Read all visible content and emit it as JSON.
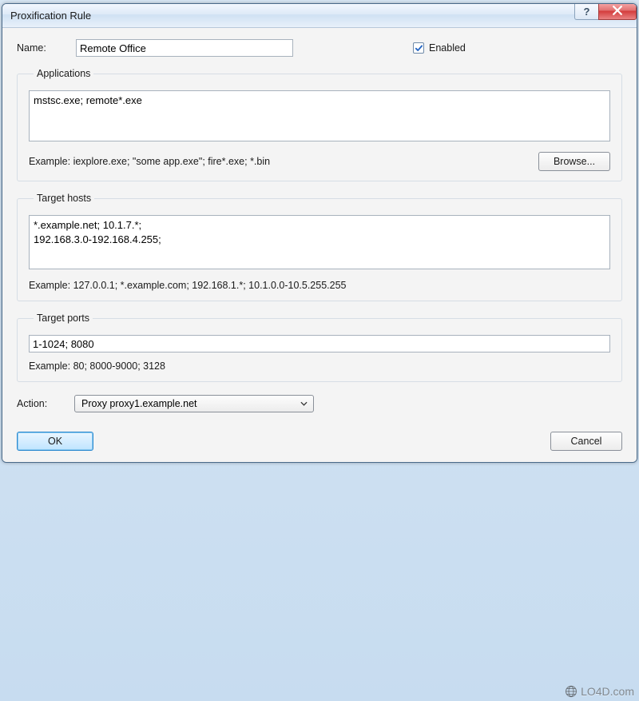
{
  "window": {
    "title": "Proxification Rule"
  },
  "name": {
    "label": "Name:",
    "value": "Remote Office"
  },
  "enabled": {
    "label": "Enabled",
    "checked": true
  },
  "applications": {
    "legend": "Applications",
    "value": "mstsc.exe; remote*.exe",
    "example": "Example: iexplore.exe; \"some app.exe\"; fire*.exe; *.bin",
    "browse_label": "Browse..."
  },
  "target_hosts": {
    "legend": "Target hosts",
    "value": "*.example.net; 10.1.7.*;\n192.168.3.0-192.168.4.255;",
    "example": "Example: 127.0.0.1; *.example.com; 192.168.1.*; 10.1.0.0-10.5.255.255"
  },
  "target_ports": {
    "legend": "Target ports",
    "value": "1-1024; 8080",
    "example": "Example: 80; 8000-9000; 3128"
  },
  "action": {
    "label": "Action:",
    "selected": "Proxy proxy1.example.net"
  },
  "buttons": {
    "ok": "OK",
    "cancel": "Cancel"
  },
  "watermark": "LO4D.com"
}
